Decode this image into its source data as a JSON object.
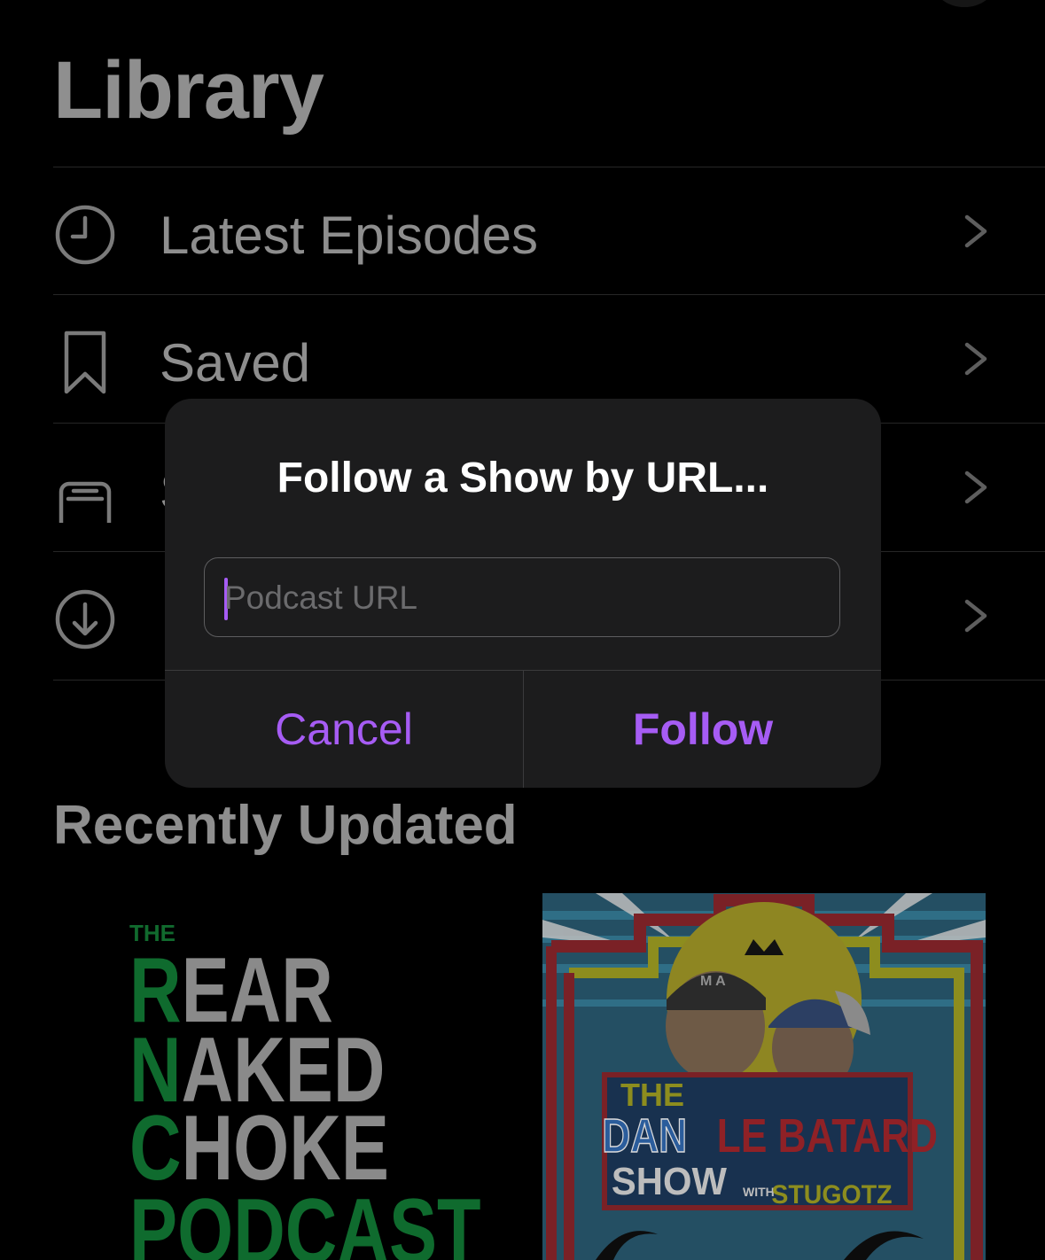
{
  "page": {
    "title": "Library"
  },
  "menu": [
    {
      "label": "Latest Episodes",
      "icon": "clock-icon"
    },
    {
      "label": "Saved",
      "icon": "bookmark-icon"
    },
    {
      "label": "S",
      "icon": "stack-icon"
    },
    {
      "label": "",
      "icon": "download-icon"
    }
  ],
  "section": {
    "title": "Recently Updated"
  },
  "covers": [
    {
      "line1": "THE",
      "line2_first": "R",
      "line2_rest": "EAR",
      "line3_first": "N",
      "line3_rest": "AKED",
      "line4_first": "C",
      "line4_rest": "HOKE",
      "line5": "PODCAST"
    },
    {
      "title_a": "THE",
      "title_b": "DAN",
      "title_c": "LE BATARD",
      "title_d": "SHOW",
      "with": "WITH",
      "with_name": "STUGOTZ",
      "cap_text": "M A"
    }
  ],
  "dialog": {
    "title": "Follow a Show by URL...",
    "placeholder": "Podcast URL",
    "value": "",
    "cancel_label": "Cancel",
    "follow_label": "Follow"
  },
  "colors": {
    "accent": "#a65cf4",
    "background": "#000000",
    "dialog_bg": "#1c1c1d"
  }
}
